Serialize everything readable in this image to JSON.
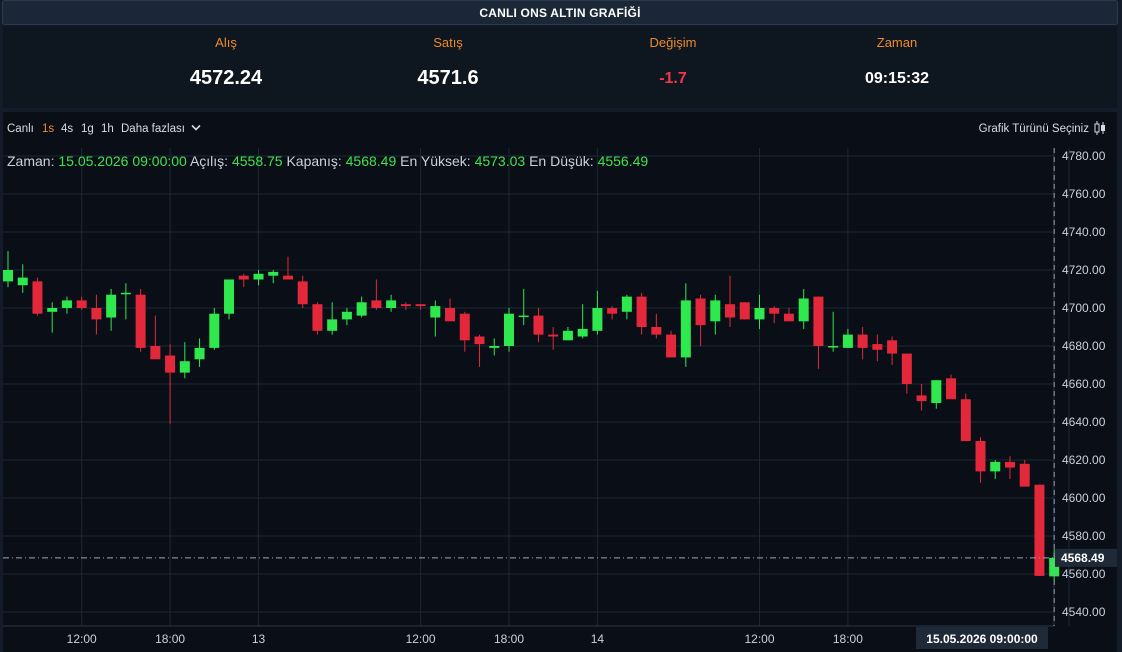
{
  "header": {
    "title": "CANLI ONS ALTIN GRAFİĞİ"
  },
  "ticker": {
    "bid_label": "Alış",
    "bid_value": "4572.24",
    "ask_label": "Satış",
    "ask_value": "4571.6",
    "change_label": "Değişim",
    "change_value": "-1.7",
    "time_label": "Zaman",
    "time_value": "09:15:32"
  },
  "toolbar": {
    "live": "Canlı",
    "intervals": [
      "1s",
      "4s",
      "1g",
      "1h"
    ],
    "active_interval": "1s",
    "more": "Daha fazlası",
    "chart_type": "Grafik Türünü Seçiniz"
  },
  "legend": {
    "time_label": "Zaman:",
    "time_value": "15.05.2026 09:00:00",
    "open_label": "Açılış:",
    "open_value": "4558.75",
    "close_label": "Kapanış:",
    "close_value": "4568.49",
    "high_label": "En Yüksek:",
    "high_value": "4573.03",
    "low_label": "En Düşük:",
    "low_value": "4556.49"
  },
  "colors": {
    "up": "#2fe84d",
    "down": "#e3283b",
    "background": "#0a0f17",
    "grid": "#1c2836",
    "accent": "#ef8a2c"
  },
  "chart_data": {
    "type": "candlestick",
    "interval": "1 hour",
    "ylim": [
      4535,
      4780
    ],
    "y_ticks": [
      "4540.00",
      "4560.00",
      "4580.00",
      "4600.00",
      "4620.00",
      "4640.00",
      "4660.00",
      "4680.00",
      "4700.00",
      "4720.00",
      "4740.00",
      "4760.00",
      "4780.00"
    ],
    "x_ticks": [
      "12:00",
      "18:00",
      "13",
      "12:00",
      "18:00",
      "14",
      "12:00",
      "18:00",
      "09:00:00"
    ],
    "x_tick_candle_index": [
      5,
      11,
      17,
      28,
      34,
      40,
      51,
      57,
      72
    ],
    "crosshair": {
      "price": "4568.49",
      "time": "15.05.2026  09:00:00"
    },
    "candles": [
      {
        "o": 4714,
        "h": 4730,
        "l": 4711,
        "c": 4720
      },
      {
        "o": 4712,
        "h": 4723,
        "l": 4708,
        "c": 4716
      },
      {
        "o": 4714,
        "h": 4716,
        "l": 4696,
        "c": 4697
      },
      {
        "o": 4698,
        "h": 4703,
        "l": 4687,
        "c": 4700
      },
      {
        "o": 4700,
        "h": 4706,
        "l": 4697,
        "c": 4704
      },
      {
        "o": 4704,
        "h": 4706,
        "l": 4699,
        "c": 4700
      },
      {
        "o": 4700,
        "h": 4707,
        "l": 4686,
        "c": 4694
      },
      {
        "o": 4695,
        "h": 4710,
        "l": 4688,
        "c": 4707
      },
      {
        "o": 4708,
        "h": 4713,
        "l": 4694,
        "c": 4708
      },
      {
        "o": 4707,
        "h": 4710,
        "l": 4677,
        "c": 4679
      },
      {
        "o": 4680,
        "h": 4696,
        "l": 4675,
        "c": 4673
      },
      {
        "o": 4675,
        "h": 4681,
        "l": 4639,
        "c": 4666
      },
      {
        "o": 4666,
        "h": 4682,
        "l": 4663,
        "c": 4672
      },
      {
        "o": 4673,
        "h": 4684,
        "l": 4669,
        "c": 4679
      },
      {
        "o": 4679,
        "h": 4700,
        "l": 4678,
        "c": 4697
      },
      {
        "o": 4697,
        "h": 4715,
        "l": 4694,
        "c": 4715
      },
      {
        "o": 4717,
        "h": 4718,
        "l": 4711,
        "c": 4715
      },
      {
        "o": 4715,
        "h": 4720,
        "l": 4712,
        "c": 4718
      },
      {
        "o": 4717,
        "h": 4720,
        "l": 4713,
        "c": 4719
      },
      {
        "o": 4717,
        "h": 4727,
        "l": 4715,
        "c": 4715
      },
      {
        "o": 4714,
        "h": 4717,
        "l": 4700,
        "c": 4702
      },
      {
        "o": 4702,
        "h": 4703,
        "l": 4686,
        "c": 4688
      },
      {
        "o": 4688,
        "h": 4703,
        "l": 4686,
        "c": 4694
      },
      {
        "o": 4694,
        "h": 4700,
        "l": 4691,
        "c": 4698
      },
      {
        "o": 4696,
        "h": 4706,
        "l": 4695,
        "c": 4703
      },
      {
        "o": 4704,
        "h": 4715,
        "l": 4699,
        "c": 4700
      },
      {
        "o": 4700,
        "h": 4707,
        "l": 4698,
        "c": 4704
      },
      {
        "o": 4702,
        "h": 4703,
        "l": 4699,
        "c": 4701
      },
      {
        "o": 4702,
        "h": 4702,
        "l": 4699,
        "c": 4701
      },
      {
        "o": 4695,
        "h": 4704,
        "l": 4685,
        "c": 4701
      },
      {
        "o": 4700,
        "h": 4705,
        "l": 4694,
        "c": 4693
      },
      {
        "o": 4697,
        "h": 4698,
        "l": 4677,
        "c": 4683
      },
      {
        "o": 4685,
        "h": 4686,
        "l": 4669,
        "c": 4681
      },
      {
        "o": 4679,
        "h": 4684,
        "l": 4675,
        "c": 4680
      },
      {
        "o": 4680,
        "h": 4700,
        "l": 4677,
        "c": 4697
      },
      {
        "o": 4696,
        "h": 4710,
        "l": 4691,
        "c": 4696
      },
      {
        "o": 4696,
        "h": 4700,
        "l": 4682,
        "c": 4686
      },
      {
        "o": 4686,
        "h": 4690,
        "l": 4678,
        "c": 4685
      },
      {
        "o": 4683,
        "h": 4690,
        "l": 4683,
        "c": 4688
      },
      {
        "o": 4685,
        "h": 4702,
        "l": 4684,
        "c": 4689
      },
      {
        "o": 4688,
        "h": 4709,
        "l": 4686,
        "c": 4700
      },
      {
        "o": 4700,
        "h": 4701,
        "l": 4694,
        "c": 4697
      },
      {
        "o": 4698,
        "h": 4707,
        "l": 4694,
        "c": 4706
      },
      {
        "o": 4706,
        "h": 4708,
        "l": 4686,
        "c": 4690
      },
      {
        "o": 4690,
        "h": 4697,
        "l": 4684,
        "c": 4686
      },
      {
        "o": 4686,
        "h": 4688,
        "l": 4675,
        "c": 4674
      },
      {
        "o": 4674,
        "h": 4713,
        "l": 4669,
        "c": 4704
      },
      {
        "o": 4705,
        "h": 4707,
        "l": 4680,
        "c": 4691
      },
      {
        "o": 4693,
        "h": 4707,
        "l": 4686,
        "c": 4704
      },
      {
        "o": 4702,
        "h": 4717,
        "l": 4690,
        "c": 4695
      },
      {
        "o": 4703,
        "h": 4703,
        "l": 4694,
        "c": 4694
      },
      {
        "o": 4694,
        "h": 4707,
        "l": 4689,
        "c": 4700
      },
      {
        "o": 4700,
        "h": 4701,
        "l": 4692,
        "c": 4697
      },
      {
        "o": 4697,
        "h": 4700,
        "l": 4694,
        "c": 4693
      },
      {
        "o": 4693,
        "h": 4710,
        "l": 4689,
        "c": 4705
      },
      {
        "o": 4706,
        "h": 4706,
        "l": 4668,
        "c": 4680
      },
      {
        "o": 4680,
        "h": 4698,
        "l": 4677,
        "c": 4680
      },
      {
        "o": 4679,
        "h": 4689,
        "l": 4679,
        "c": 4686
      },
      {
        "o": 4686,
        "h": 4690,
        "l": 4673,
        "c": 4679
      },
      {
        "o": 4681,
        "h": 4686,
        "l": 4672,
        "c": 4678
      },
      {
        "o": 4683,
        "h": 4685,
        "l": 4670,
        "c": 4676
      },
      {
        "o": 4676,
        "h": 4676,
        "l": 4655,
        "c": 4660
      },
      {
        "o": 4654,
        "h": 4660,
        "l": 4646,
        "c": 4651
      },
      {
        "o": 4650,
        "h": 4662,
        "l": 4647,
        "c": 4662
      },
      {
        "o": 4663,
        "h": 4665,
        "l": 4653,
        "c": 4652
      },
      {
        "o": 4652,
        "h": 4655,
        "l": 4630,
        "c": 4630
      },
      {
        "o": 4630,
        "h": 4632,
        "l": 4608,
        "c": 4614
      },
      {
        "o": 4614,
        "h": 4620,
        "l": 4610,
        "c": 4619
      },
      {
        "o": 4619,
        "h": 4622,
        "l": 4610,
        "c": 4616
      },
      {
        "o": 4618,
        "h": 4620,
        "l": 4606,
        "c": 4606
      },
      {
        "o": 4607,
        "h": 4607,
        "l": 4559,
        "c": 4559
      },
      {
        "o": 4558.75,
        "h": 4573.03,
        "l": 4556.49,
        "c": 4568.49
      }
    ]
  }
}
